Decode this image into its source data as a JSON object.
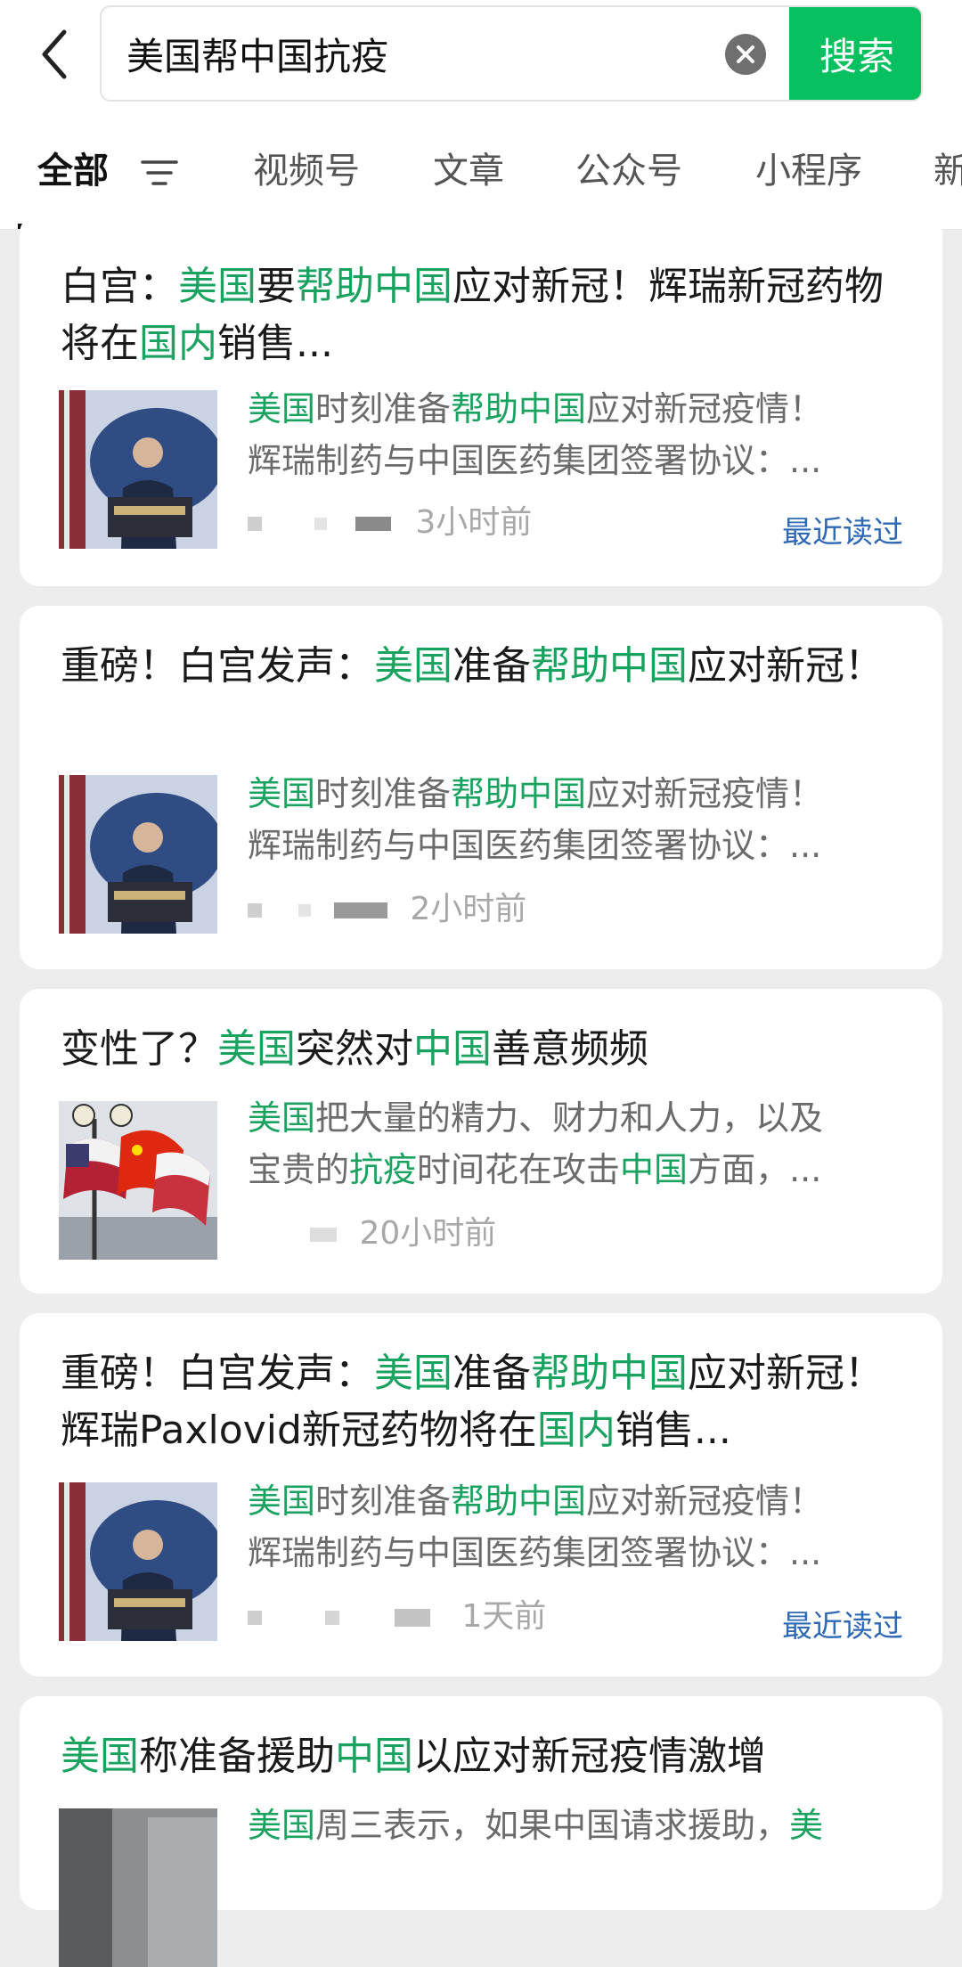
{
  "search": {
    "query": "美国帮中国抗疫",
    "button_label": "搜索"
  },
  "tabs": [
    {
      "label": "全部"
    },
    {
      "label": "视频号"
    },
    {
      "label": "文章"
    },
    {
      "label": "公众号"
    },
    {
      "label": "小程序"
    },
    {
      "label": "新"
    }
  ],
  "colors": {
    "accent": "#07c160",
    "highlight": "#1aa260",
    "recent_link": "#2f69b5"
  },
  "results": [
    {
      "title_parts": [
        {
          "t": "白宫："
        },
        {
          "t": "美国",
          "hl": true
        },
        {
          "t": "要"
        },
        {
          "t": "帮助中国",
          "hl": true
        },
        {
          "t": "应对新冠！辉瑞新冠"
        },
        {
          "t": "药物将在"
        },
        {
          "t": "国内",
          "hl": true
        },
        {
          "t": "销售..."
        }
      ],
      "snippet_lines": [
        [
          {
            "t": "美国",
            "hl": true
          },
          {
            "t": "时刻准备"
          },
          {
            "t": "帮助中国",
            "hl": true
          },
          {
            "t": "应对新冠疫情！"
          }
        ],
        [
          {
            "t": "辉瑞制药与中国医药集团签署协议：..."
          }
        ]
      ],
      "time": "3小时前",
      "recent_label": "最近读过",
      "thumb": "white-house-briefing-image"
    },
    {
      "title_parts": [
        {
          "t": "重磅！白宫发声："
        },
        {
          "t": "美国",
          "hl": true
        },
        {
          "t": "准备"
        },
        {
          "t": "帮助中国",
          "hl": true
        },
        {
          "t": "应对新冠！"
        }
      ],
      "snippet_lines": [
        [
          {
            "t": "美国",
            "hl": true
          },
          {
            "t": "时刻准备"
          },
          {
            "t": "帮助中国",
            "hl": true
          },
          {
            "t": "应对新冠疫情！"
          }
        ],
        [
          {
            "t": "辉瑞制药与中国医药集团签署协议：..."
          }
        ]
      ],
      "time": "2小时前",
      "recent_label": "",
      "thumb": "white-house-briefing-image"
    },
    {
      "title_parts": [
        {
          "t": "变性了？"
        },
        {
          "t": "美国",
          "hl": true
        },
        {
          "t": "突然对"
        },
        {
          "t": "中国",
          "hl": true
        },
        {
          "t": "善意频频"
        }
      ],
      "snippet_lines": [
        [
          {
            "t": "美国",
            "hl": true
          },
          {
            "t": "把大量的精力、财力和人力，以及"
          }
        ],
        [
          {
            "t": "宝贵的"
          },
          {
            "t": "抗疫",
            "hl": true
          },
          {
            "t": "时间花在攻击"
          },
          {
            "t": "中国",
            "hl": true
          },
          {
            "t": "方面，..."
          }
        ]
      ],
      "time": "20小时前",
      "recent_label": "",
      "thumb": "us-china-flags-image"
    },
    {
      "title_parts": [
        {
          "t": "重磅！白宫发声："
        },
        {
          "t": "美国",
          "hl": true
        },
        {
          "t": "准备"
        },
        {
          "t": "帮助中国",
          "hl": true
        },
        {
          "t": "应对新"
        },
        {
          "t": "冠！辉瑞Paxlovid新冠药物将在"
        },
        {
          "t": "国内",
          "hl": true
        },
        {
          "t": "销售..."
        }
      ],
      "snippet_lines": [
        [
          {
            "t": "美国",
            "hl": true
          },
          {
            "t": "时刻准备"
          },
          {
            "t": "帮助中国",
            "hl": true
          },
          {
            "t": "应对新冠疫情！"
          }
        ],
        [
          {
            "t": "辉瑞制药与中国医药集团签署协议：..."
          }
        ]
      ],
      "time": "1天前",
      "recent_label": "最近读过",
      "thumb": "white-house-briefing-image"
    },
    {
      "title_parts": [
        {
          "t": "美国",
          "hl": true
        },
        {
          "t": "称准备援助"
        },
        {
          "t": "中国",
          "hl": true
        },
        {
          "t": "以应对新冠疫情激增"
        }
      ],
      "snippet_lines": [
        [
          {
            "t": "美国",
            "hl": true
          },
          {
            "t": "周三表示，如果中国请求援助，"
          },
          {
            "t": "美",
            "hl": true
          }
        ]
      ],
      "time": "",
      "recent_label": "",
      "thumb": "street-photo-image"
    }
  ]
}
